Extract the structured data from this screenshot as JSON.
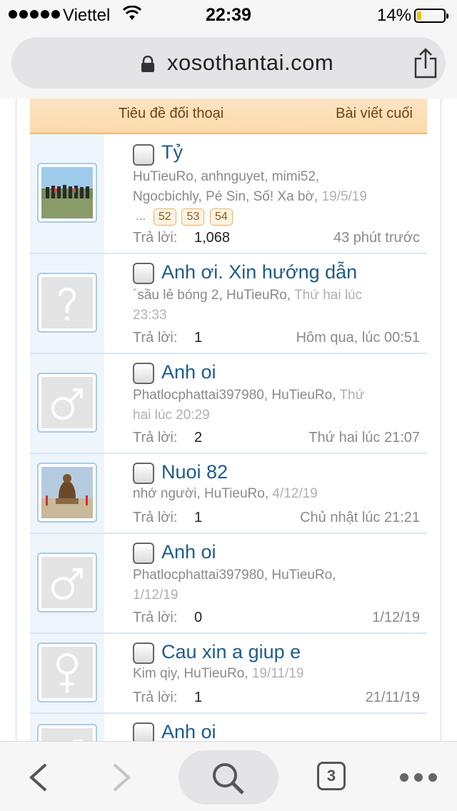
{
  "status_bar": {
    "carrier": "Viettel",
    "time": "22:39",
    "battery": "14%",
    "battery_level": 0.14,
    "signal_icon": "signal-dots-icon",
    "wifi_icon": "wifi-icon"
  },
  "browser": {
    "url": "xosothantai.com",
    "lock_icon": "lock-icon",
    "share_icon": "share-icon",
    "tabs_count": "3"
  },
  "table_header": {
    "title_col": "Tiêu đề đối thoại",
    "last_col": "Bài viết cuối"
  },
  "threads": [
    {
      "title": "Tỷ",
      "participants_line1": "HuTieuRo, anhnguyet, mimi52,",
      "participants_line2": "Ngocbichly, Pé Sin, Số! Xa bờ,",
      "date": "19/5/19",
      "pages_prefix": "...",
      "pages": [
        "52",
        "53",
        "54"
      ],
      "reply_label": "Trả lời:",
      "replies": "1,068",
      "last_post": "43 phút trước",
      "avatar": "photo-beach"
    },
    {
      "title": "Anh ơi. Xin hướng dẫn",
      "participants": "´sầu lẻ bóng 2, HuTieuRo,",
      "date_line1": "Thứ hai lúc",
      "date_line2": "23:33",
      "reply_label": "Trả lời:",
      "replies": "1",
      "last_post": "Hôm qua, lúc 00:51",
      "avatar": "unknown-gender-icon"
    },
    {
      "title": "Anh oi",
      "participants": "Phatlocphattai397980, HuTieuRo,",
      "date_line1": "Thứ",
      "date_line2": "hai lúc 20:29",
      "reply_label": "Trả lời:",
      "replies": "2",
      "last_post": "Thứ hai lúc 21:07",
      "avatar": "male-icon"
    },
    {
      "title": "Nuoi 82",
      "participants": "nhớ người, HuTieuRo,",
      "date": "4/12/19",
      "reply_label": "Trả lời:",
      "replies": "1",
      "last_post": "Chủ nhật lúc 21:21",
      "avatar": "photo-statue"
    },
    {
      "title": "Anh oi",
      "participants": "Phatlocphattai397980, HuTieuRo,",
      "date": "1/12/19",
      "reply_label": "Trả lời:",
      "replies": "0",
      "last_post": "1/12/19",
      "avatar": "male-icon"
    },
    {
      "title": "Cau xin a giup e",
      "participants": "Kim qiy, HuTieuRo,",
      "date": "19/11/19",
      "reply_label": "Trả lời:",
      "replies": "1",
      "last_post": "21/11/19",
      "avatar": "female-icon"
    },
    {
      "title": "Anh oi",
      "avatar": "male-icon"
    }
  ]
}
